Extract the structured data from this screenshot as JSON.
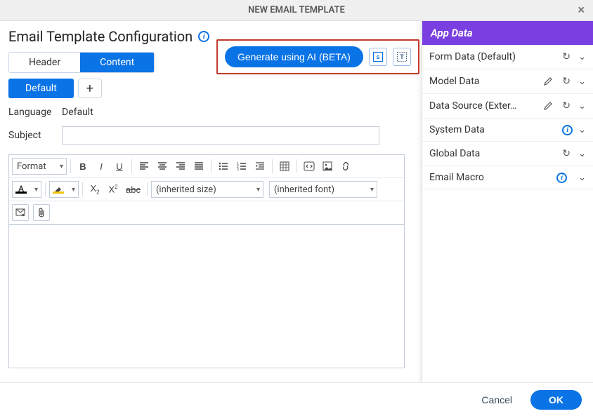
{
  "modal": {
    "title": "NEW EMAIL TEMPLATE"
  },
  "page": {
    "title": "Email Template Configuration"
  },
  "tabs": {
    "header": "Header",
    "content": "Content"
  },
  "subtabs": {
    "default": "Default"
  },
  "ai": {
    "button": "Generate using AI (BETA)"
  },
  "form": {
    "language_label": "Language",
    "language_value": "Default",
    "subject_label": "Subject",
    "subject_value": ""
  },
  "toolbar": {
    "format": "Format",
    "size_placeholder": "(inherited size)",
    "font_placeholder": "(inherited font)"
  },
  "sidepanel": {
    "title": "App Data",
    "items": {
      "form": "Form Data (Default)",
      "model": "Model Data",
      "datasource": "Data Source (Exter…",
      "system": "System Data",
      "global": "Global Data",
      "macro": "Email Macro"
    }
  },
  "footer": {
    "cancel": "Cancel",
    "ok": "OK"
  }
}
